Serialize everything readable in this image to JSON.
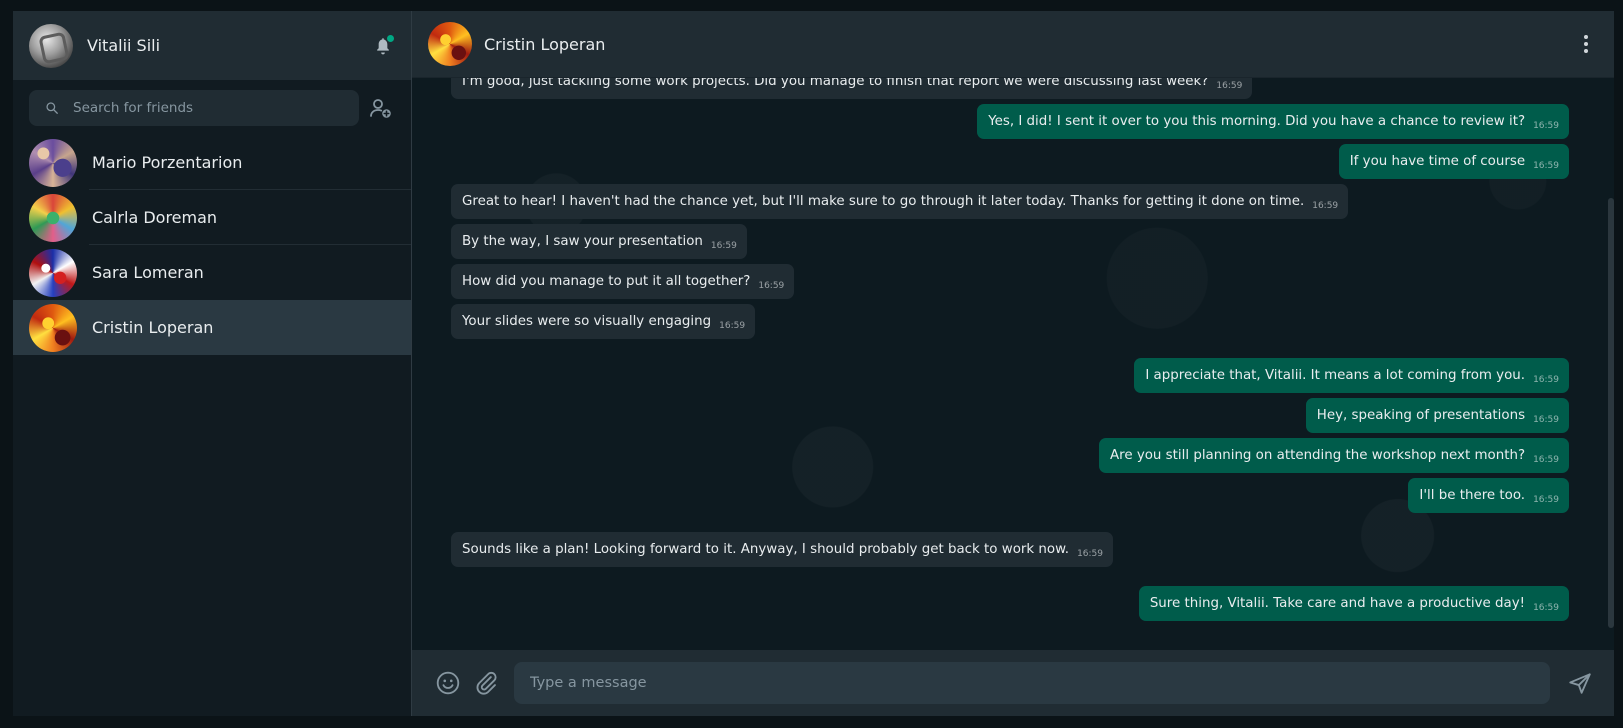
{
  "me": {
    "name": "Vitalii Sili"
  },
  "search": {
    "placeholder": "Search for friends"
  },
  "contacts": [
    {
      "name": "Mario Porzentarion"
    },
    {
      "name": "Calrla Doreman"
    },
    {
      "name": "Sara Lomeran"
    },
    {
      "name": "Cristin Loperan"
    }
  ],
  "active_chat": {
    "name": "Cristin Loperan"
  },
  "messages": [
    {
      "dir": "in",
      "text": "I'm good, just tackling some work projects. Did you manage to finish that report we were discussing last week?",
      "time": "16:59"
    },
    {
      "dir": "out",
      "text": "Yes, I did! I sent it over to you this morning. Did you have a chance to review it?",
      "time": "16:59"
    },
    {
      "dir": "out",
      "text": "If you have time of course",
      "time": "16:59"
    },
    {
      "dir": "in",
      "text": "Great to hear! I haven't had the chance yet, but I'll make sure to go through it later today. Thanks for getting it done on time.",
      "time": "16:59"
    },
    {
      "dir": "in",
      "text": "By the way, I saw your presentation",
      "time": "16:59"
    },
    {
      "dir": "in",
      "text": "How did you manage to put it all together?",
      "time": "16:59"
    },
    {
      "dir": "in",
      "text": "Your slides were so visually engaging",
      "time": "16:59"
    },
    {
      "dir": "out",
      "text": "I appreciate that, Vitalii. It means a lot coming from you.",
      "time": "16:59"
    },
    {
      "dir": "out",
      "text": "Hey, speaking of presentations",
      "time": "16:59"
    },
    {
      "dir": "out",
      "text": "Are you still planning on attending the workshop next month?",
      "time": "16:59"
    },
    {
      "dir": "out",
      "text": "I'll be there too.",
      "time": "16:59"
    },
    {
      "dir": "in",
      "text": "Sounds like a plan! Looking forward to it. Anyway, I should probably get back to work now.",
      "time": "16:59"
    },
    {
      "dir": "out",
      "text": "Sure thing, Vitalii. Take care and have a productive day!",
      "time": "16:59"
    }
  ],
  "composer": {
    "placeholder": "Type a message"
  },
  "colors": {
    "accent": "#00a884",
    "outgoing_bubble": "#005c4b",
    "incoming_bubble": "#202c33"
  },
  "icons": [
    "bell-icon",
    "search-icon",
    "add-friend-icon",
    "more-options-icon",
    "emoji-icon",
    "attach-icon",
    "send-icon"
  ]
}
